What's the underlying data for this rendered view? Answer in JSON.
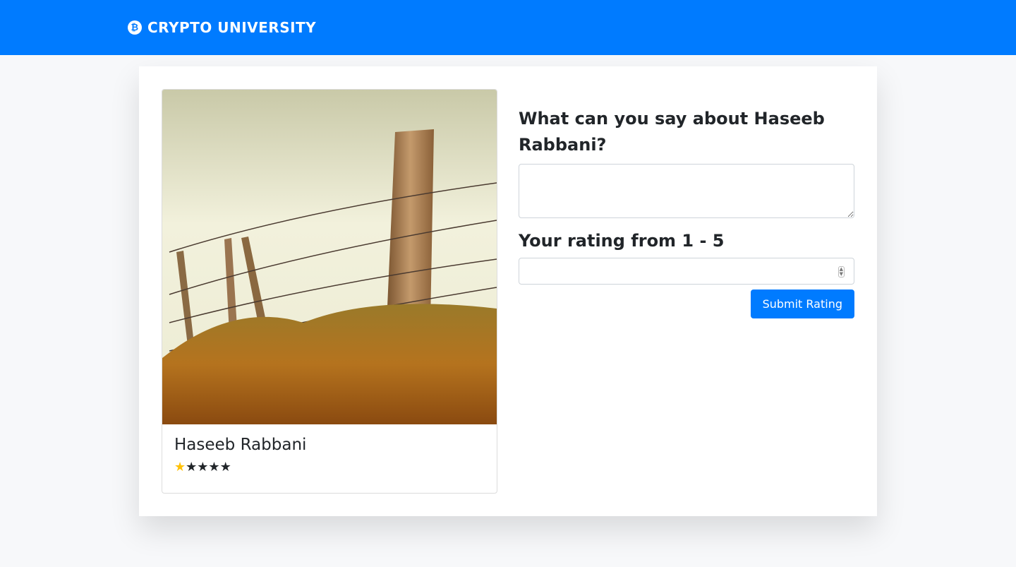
{
  "header": {
    "brand": "CRYPTO UNIVERSITY",
    "logo_icon": "bitcoin-icon",
    "logo_glyph": "₿",
    "color": "#007bff"
  },
  "profile": {
    "name": "Haseeb Rabbani",
    "rating": 1,
    "max_rating": 5,
    "star_on_color": "#ffc107"
  },
  "form": {
    "question": "What can you say about Haseeb Rabbani?",
    "comment_value": "",
    "rating_label": "Your rating from 1 - 5",
    "rating_value": "",
    "submit_label": "Submit Rating"
  }
}
